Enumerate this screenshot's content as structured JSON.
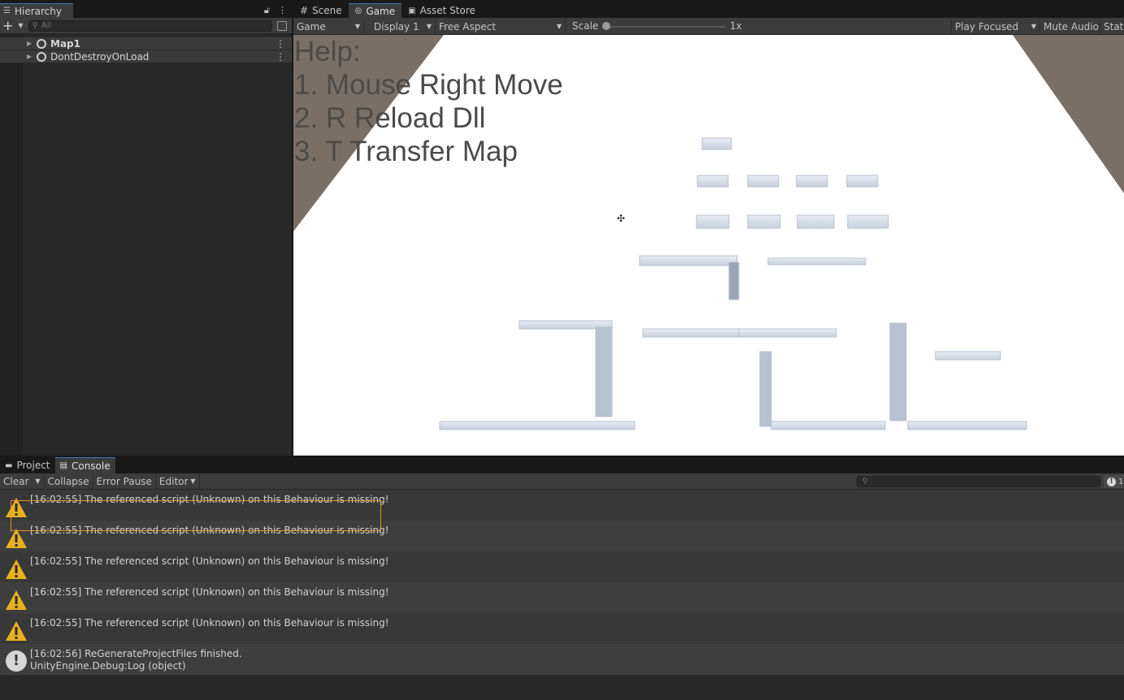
{
  "hierarchy": {
    "tab_label": "Hierarchy",
    "search_placeholder": "All",
    "items": [
      {
        "label": "Map1"
      },
      {
        "label": "DontDestroyOnLoad"
      }
    ]
  },
  "game": {
    "tabs": [
      {
        "label": "Scene",
        "icon": "grid-icon"
      },
      {
        "label": "Game",
        "icon": "gamepad-icon"
      },
      {
        "label": "Asset Store",
        "icon": "bag-icon"
      }
    ],
    "toolbar": {
      "view_mode": "Game",
      "display": "Display 1",
      "aspect": "Free Aspect",
      "scale_label": "Scale",
      "scale_value": "1x",
      "play_mode": "Play Focused",
      "mute_audio": "Mute Audio",
      "stats": "Stats"
    },
    "help": {
      "title": "Help:",
      "lines": [
        "1. Mouse Right Move",
        "2. R Reload Dll",
        "3. T Transfer Map"
      ]
    }
  },
  "console": {
    "tabs": [
      {
        "label": "Project",
        "icon": "folder-icon"
      },
      {
        "label": "Console",
        "icon": "console-icon"
      }
    ],
    "toolbar": {
      "clear": "Clear",
      "collapse": "Collapse",
      "error_pause": "Error Pause",
      "editor": "Editor",
      "count": "1"
    },
    "entries": [
      {
        "type": "warning",
        "text": "[16:02:55] The referenced script (Unknown) on this Behaviour is missing!",
        "selected": true
      },
      {
        "type": "warning",
        "text": "[16:02:55] The referenced script (Unknown) on this Behaviour is missing!"
      },
      {
        "type": "warning",
        "text": "[16:02:55] The referenced script (Unknown) on this Behaviour is missing!"
      },
      {
        "type": "warning",
        "text": "[16:02:55] The referenced script (Unknown) on this Behaviour is missing!"
      },
      {
        "type": "warning",
        "text": "[16:02:55] The referenced script (Unknown) on this Behaviour is missing!"
      },
      {
        "type": "info",
        "text": "[16:02:56] ReGenerateProjectFiles finished.",
        "text2": "UnityEngine.Debug:Log (object)"
      }
    ]
  },
  "colors": {
    "accent": "#3a79bb",
    "warning": "#e8b21e",
    "selection_outline": "#e0952d"
  }
}
